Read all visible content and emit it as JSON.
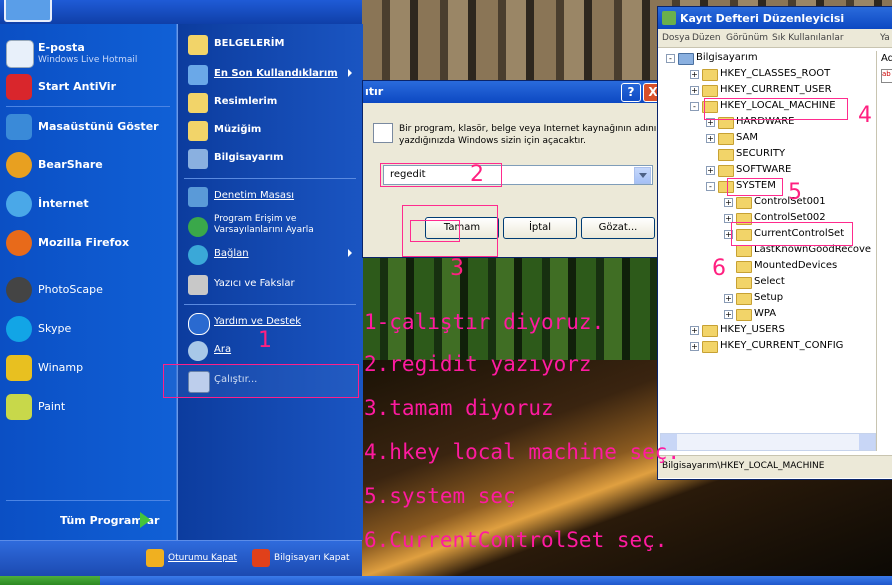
{
  "start_menu": {
    "pinned": [
      {
        "title": "E-posta",
        "subtitle": "Windows Live Hotmail"
      },
      {
        "title": "Start AntiVir",
        "subtitle": ""
      }
    ],
    "recent": [
      "Masaüstünü Göster",
      "BearShare",
      "İnternet",
      "Mozilla Firefox",
      "PhotoScape",
      "Skype",
      "Winamp",
      "Paint"
    ],
    "all_programs": "Tüm Programlar",
    "places": [
      {
        "label": "BELGELERİM",
        "bold": true
      },
      {
        "label": "En Son Kullandıklarım",
        "bold": true,
        "arrow": true
      },
      {
        "label": "Resimlerim",
        "bold": true
      },
      {
        "label": "Müziğim",
        "bold": true
      },
      {
        "label": "Bilgisayarım",
        "bold": true
      },
      {
        "label": "Denetim Masası"
      },
      {
        "label_line1": "Program Erişim ve",
        "label_line2": "Varsayılanlarını Ayarla"
      },
      {
        "label": "Bağlan",
        "arrow": true
      },
      {
        "label": "Yazıcı ve Fakslar"
      },
      {
        "label": "Yardım ve Destek"
      },
      {
        "label": "Ara"
      },
      {
        "label": "Çalıştır..."
      }
    ],
    "logoff": "Oturumu Kapat",
    "shutdown": "Bilgisayarı Kapat"
  },
  "run_dialog": {
    "title": "ıtır",
    "message": "Bir program, klasör, belge veya Internet kaynağının adını yazdığınızda Windows sizin için açacaktır.",
    "input_value": "regedit",
    "ok": "Tamam",
    "cancel": "İptal",
    "browse": "Gözat...",
    "help_btn": "?",
    "close_btn": "X"
  },
  "regedit": {
    "title": "Kayıt Defteri Düzenleyicisi",
    "menu": [
      "Dosya",
      "Düzen",
      "Görünüm",
      "Sık Kullanılanlar",
      "Ya"
    ],
    "tree": [
      {
        "label": "Bilgisayarım",
        "level": 0
      },
      {
        "label": "HKEY_CLASSES_ROOT",
        "level": 1
      },
      {
        "label": "HKEY_CURRENT_USER",
        "level": 1
      },
      {
        "label": "HKEY_LOCAL_MACHINE",
        "level": 1
      },
      {
        "label": "HARDWARE",
        "level": 2
      },
      {
        "label": "SAM",
        "level": 2
      },
      {
        "label": "SECURITY",
        "level": 2
      },
      {
        "label": "SOFTWARE",
        "level": 2
      },
      {
        "label": "SYSTEM",
        "level": 2
      },
      {
        "label": "ControlSet001",
        "level": 3
      },
      {
        "label": "ControlSet002",
        "level": 3
      },
      {
        "label": "CurrentControlSet",
        "level": 3
      },
      {
        "label": "LastKnownGoodRecove",
        "level": 3
      },
      {
        "label": "MountedDevices",
        "level": 3
      },
      {
        "label": "Select",
        "level": 3
      },
      {
        "label": "Setup",
        "level": 3
      },
      {
        "label": "WPA",
        "level": 3
      },
      {
        "label": "HKEY_USERS",
        "level": 1
      },
      {
        "label": "HKEY_CURRENT_CONFIG",
        "level": 1
      }
    ],
    "right_header": "Ad",
    "status": "Bilgisayarım\\HKEY_LOCAL_MACHINE"
  },
  "annotations": {
    "numbers": [
      "1",
      "2",
      "3",
      "4",
      "5",
      "6"
    ],
    "steps": [
      "1-çalıştır diyoruz.",
      "2.regidit yazıyorz",
      "3.tamam diyoruz",
      "4.hkey local machine seç.",
      "5.system seç",
      "6.CurrentControlSet seç."
    ]
  },
  "colors": {
    "annotation": "#ff1aa0",
    "xp_blue": "#0c48c2"
  }
}
